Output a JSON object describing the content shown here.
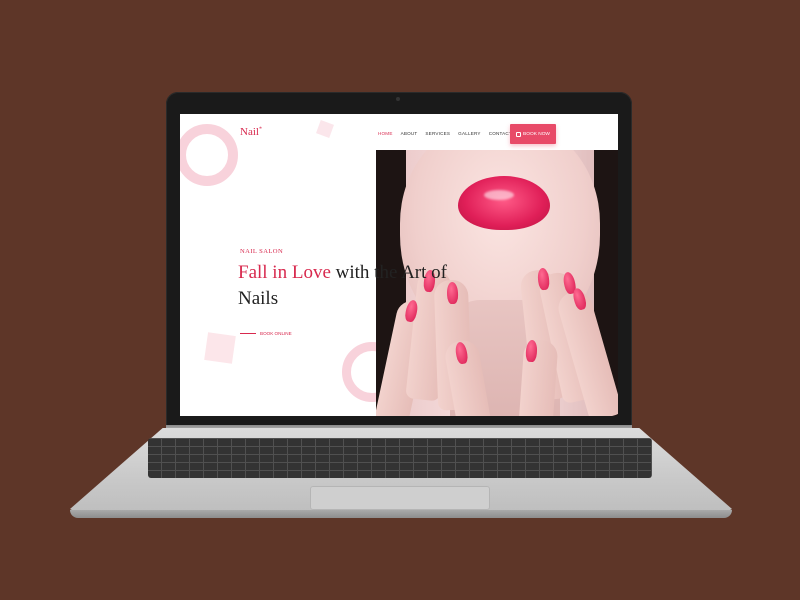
{
  "site": {
    "logo": "Nail",
    "logo_mark": "*",
    "nav": [
      {
        "label": "HOME",
        "active": true
      },
      {
        "label": "ABOUT",
        "active": false
      },
      {
        "label": "SERVICES",
        "active": false
      },
      {
        "label": "GALLERY",
        "active": false
      },
      {
        "label": "CONTACT",
        "active": false
      }
    ],
    "book_button": "BOOK NOW"
  },
  "hero": {
    "eyebrow": "NAIL SALON",
    "headline_highlight": "Fall in Love",
    "headline_rest": "with the Art of Nails",
    "cta": "BOOK ONLINE"
  },
  "colors": {
    "accent": "#d8294e",
    "button": "#e84a68",
    "background": "#5e3628",
    "decor": "#f8d2db"
  },
  "icons": {
    "book_button_icon": "calendar-icon"
  }
}
